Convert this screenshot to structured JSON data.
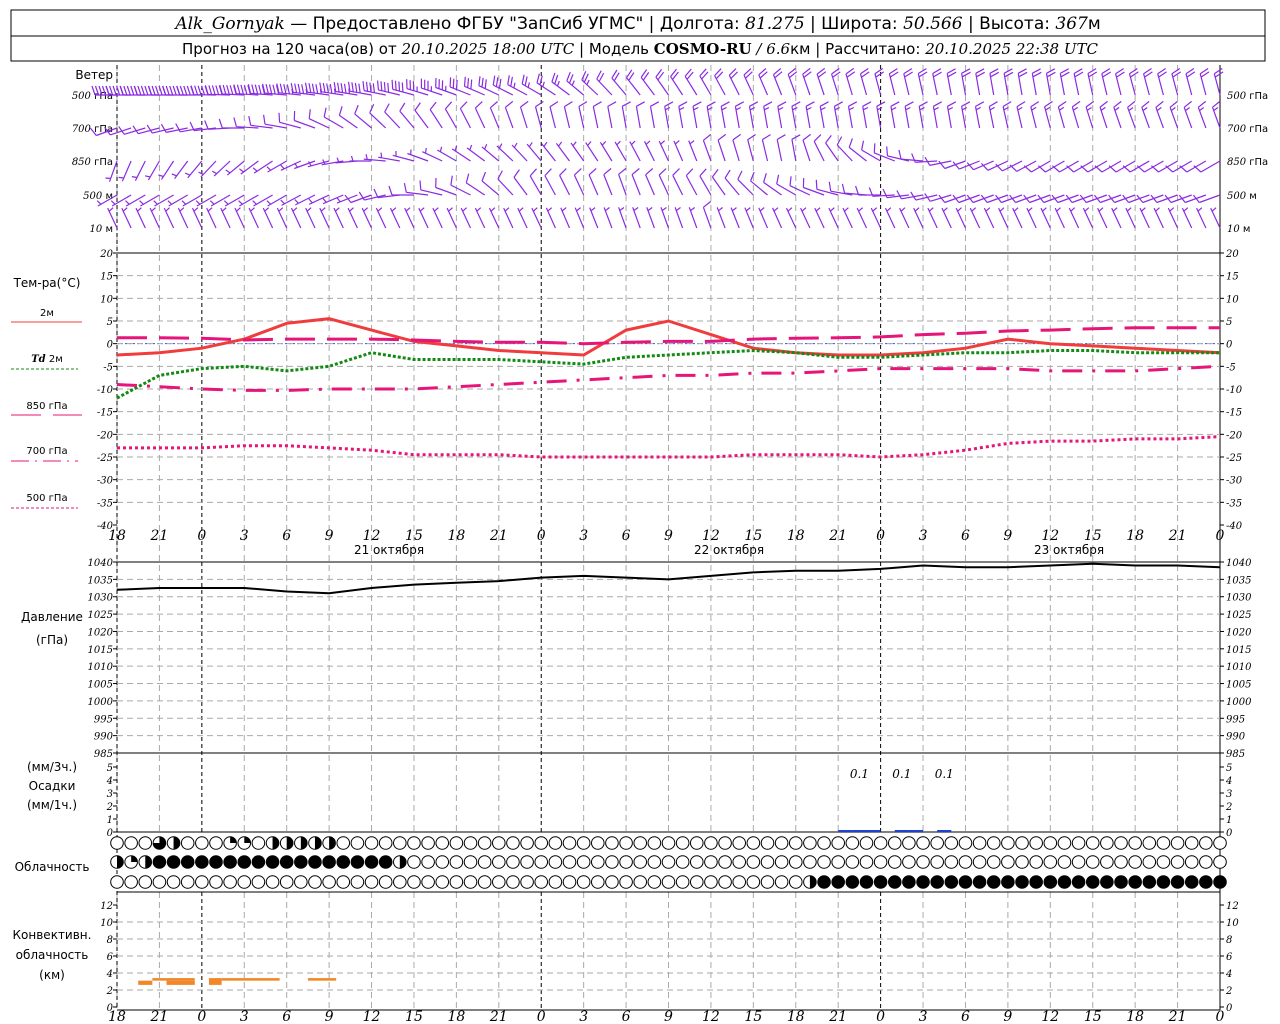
{
  "header": {
    "station": "Alk_Gornyak",
    "provided": "— Предоставлено ФГБУ \"ЗапСиб УГМС\" | Долгота:",
    "lon": "81.275",
    "lat_label": "| Широта:",
    "lat": "50.566",
    "alt_label": "| Высота:",
    "alt": "367",
    "alt_unit": "м",
    "forecast_label": "Прогноз на 120 часа(ов) от",
    "forecast_start": "20.10.2025 18:00 UTC",
    "model_label": "| Модель",
    "model": "COSMO-RU",
    "res": "/ 6.6",
    "res_unit": "км",
    "calc_label": "| Рассчитано:",
    "calc_time": "20.10.2025 22:38 UTC"
  },
  "labels": {
    "wind": "Ветер",
    "levels": [
      "500 гПа",
      "700 гПа",
      "850 гПа",
      "500 м",
      "10 м"
    ],
    "temp": "Тем-ра(°C)",
    "t2m": "2м",
    "td": "Td",
    "td2m": "2м",
    "l850": "850 гПа",
    "l700": "700 гПа",
    "l500": "500 гПа",
    "pressure": "Давление",
    "pressure_unit": "(гПа)",
    "precip3": "(мм/3ч.)",
    "precip": "Осадки",
    "precip1": "(мм/1ч.)",
    "clouds": "Облачность",
    "conv1": "Конвективн.",
    "conv2": "облачность",
    "conv3": "(км)",
    "dates": [
      "21 октября",
      "22 октября",
      "23 октября"
    ]
  },
  "colors": {
    "wind": "#8a2be2",
    "t2m": "#f03c3c",
    "td": "#138a13",
    "upper": "#e6157a",
    "precip": "#2040d0",
    "conv": "#f0882a"
  },
  "chart_data": {
    "type": "meteogram",
    "x_hours_from_start": [
      0,
      3,
      6,
      9,
      12,
      15,
      18,
      21,
      24,
      27,
      30,
      33,
      36,
      39,
      42,
      45,
      48,
      51,
      54,
      57,
      60,
      63,
      66,
      69,
      72,
      75,
      78
    ],
    "x_tick_labels": [
      "18",
      "21",
      "0",
      "3",
      "6",
      "9",
      "12",
      "15",
      "18",
      "21",
      "0",
      "3",
      "6",
      "9",
      "12",
      "15",
      "18",
      "21",
      "0",
      "3",
      "6",
      "9",
      "12",
      "15",
      "18",
      "21",
      "0"
    ],
    "temperature": {
      "ylim": [
        -40,
        20
      ],
      "yticks": [
        "20",
        "15",
        "10",
        "5",
        "0",
        "-5",
        "-10",
        "-15",
        "-20",
        "-25",
        "-30",
        "-35",
        "-40"
      ],
      "series": [
        {
          "name": "2м",
          "values": [
            -2.5,
            -2,
            -1,
            1,
            4.5,
            5.5,
            3,
            0.5,
            -0.5,
            -1.5,
            -2,
            -2.5,
            3,
            5,
            2,
            -1,
            -2,
            -2.5,
            -2.5,
            -2,
            -1,
            1,
            0,
            -0.5,
            -1,
            -1.5,
            -2
          ]
        },
        {
          "name": "Td 2м",
          "values": [
            -12,
            -7,
            -5.5,
            -5,
            -6,
            -5,
            -2,
            -3.5,
            -3.5,
            -3.5,
            -4,
            -4.5,
            -3,
            -2.5,
            -2,
            -1.5,
            -2,
            -3,
            -3,
            -2.5,
            -2,
            -2,
            -1.5,
            -1.5,
            -2,
            -2,
            -2
          ]
        },
        {
          "name": "850 гПа",
          "values": [
            1.3,
            1.3,
            1.2,
            0.8,
            1,
            1,
            1,
            0.8,
            0.5,
            0.3,
            0.3,
            0,
            0.3,
            0.5,
            0.5,
            1,
            1.2,
            1.3,
            1.5,
            2,
            2.3,
            2.8,
            3,
            3.3,
            3.5,
            3.5,
            3.5
          ]
        },
        {
          "name": "700 гПа",
          "values": [
            -9,
            -9.5,
            -10,
            -10.3,
            -10.3,
            -10,
            -10,
            -10,
            -9.5,
            -9,
            -8.5,
            -8,
            -7.5,
            -7,
            -7,
            -6.5,
            -6.5,
            -6,
            -5.5,
            -5.5,
            -5.5,
            -5.5,
            -6,
            -6,
            -6,
            -5.5,
            -5
          ]
        },
        {
          "name": "500 гПа",
          "values": [
            -23,
            -23,
            -23,
            -22.5,
            -22.5,
            -23,
            -23.5,
            -24.5,
            -24.5,
            -24.5,
            -25,
            -25,
            -25,
            -25,
            -25,
            -24.5,
            -24.5,
            -24.5,
            -25,
            -24.5,
            -23.5,
            -22,
            -21.5,
            -21.5,
            -21,
            -21,
            -20.5
          ]
        }
      ]
    },
    "pressure": {
      "ylim": [
        985,
        1040
      ],
      "yticks": [
        "1040",
        "1035",
        "1030",
        "1025",
        "1020",
        "1015",
        "1010",
        "1005",
        "1000",
        "995",
        "990",
        "985"
      ],
      "values": [
        1032,
        1032.5,
        1032.5,
        1032.5,
        1031.5,
        1031,
        1032.5,
        1033.5,
        1034,
        1034.5,
        1035.5,
        1036,
        1035.5,
        1035,
        1036,
        1037,
        1037.5,
        1037.5,
        1038,
        1039,
        1038.5,
        1038.5,
        1039,
        1039.5,
        1039,
        1039,
        1038.5
      ]
    },
    "precipitation": {
      "ylim": [
        0,
        5
      ],
      "yticks": [
        "5",
        "4",
        "3",
        "2",
        "1",
        "0"
      ],
      "hourly": [
        {
          "hour": 52,
          "mm": 0.03
        },
        {
          "hour": 53,
          "mm": 0.03
        },
        {
          "hour": 54,
          "mm": 0.03
        },
        {
          "hour": 56,
          "mm": 0.03
        },
        {
          "hour": 57,
          "mm": 0.03
        },
        {
          "hour": 59,
          "mm": 0.03
        }
      ],
      "three_hourly": [
        {
          "end_hour": 54,
          "label": "0.1"
        },
        {
          "end_hour": 57,
          "label": "0.1"
        },
        {
          "end_hour": 60,
          "label": "0.1"
        }
      ]
    },
    "cloud_cover_quarters": {
      "upper": "0003200011022222000000000000000000000000000000000000000000000000000000000000000",
      "middle": "2124444444444444444420000000000000000000000000000000000000000000000000000000000",
      "lower": "0000000000000000000000000000000000000000000000000244444444444444444444444444444"
    },
    "convective_cloud_km": {
      "ylim": [
        0,
        13
      ],
      "yticks": [
        "12",
        "10",
        "8",
        "6",
        "4",
        "2",
        "0"
      ],
      "segments": [
        [
          1.5,
          2.5,
          2.6,
          3.1
        ],
        [
          2.5,
          5.5,
          3.1,
          3.4
        ],
        [
          3.5,
          5.5,
          2.6,
          3.1
        ],
        [
          6.5,
          7.4,
          2.6,
          3.4
        ],
        [
          7.4,
          11.5,
          3.1,
          3.4
        ],
        [
          13.5,
          15.5,
          3.1,
          3.4
        ]
      ]
    },
    "wind": {
      "step_hours": 6,
      "levels": [
        {
          "name": "500 гПа",
          "dir": [
            270,
            270,
            275,
            280,
            290,
            300,
            320,
            330,
            340,
            345,
            350,
            350,
            345,
            345
          ],
          "speed": [
            25,
            25,
            25,
            22,
            18,
            14,
            12,
            12,
            12,
            12,
            12,
            12,
            12,
            12
          ]
        },
        {
          "name": "700 гПа",
          "dir": [
            250,
            260,
            280,
            310,
            330,
            345,
            350,
            350,
            350,
            350,
            350,
            345,
            340,
            340
          ],
          "speed": [
            5,
            5,
            6,
            7,
            7,
            7,
            7,
            8,
            8,
            8,
            8,
            8,
            8,
            8
          ]
        },
        {
          "name": "850 гПа",
          "dir": [
            200,
            220,
            240,
            270,
            300,
            320,
            330,
            340,
            350,
            300,
            250,
            240,
            240,
            240
          ],
          "speed": [
            4,
            4,
            4,
            3,
            3,
            3,
            4,
            5,
            5,
            5,
            5,
            5,
            5,
            6
          ]
        },
        {
          "name": "500 м",
          "dir": [
            240,
            240,
            240,
            250,
            290,
            330,
            340,
            330,
            300,
            270,
            250,
            250,
            250,
            250
          ],
          "speed": [
            3,
            3,
            4,
            5,
            6,
            6,
            5,
            5,
            6,
            6,
            6,
            6,
            6,
            6
          ]
        },
        {
          "name": "10 м",
          "dir": [
            335,
            335,
            335,
            335,
            335,
            335,
            340,
            340,
            335,
            335,
            335,
            335,
            335,
            335
          ],
          "speed": [
            4,
            4,
            4,
            4,
            4,
            4,
            4,
            5,
            4,
            4,
            4,
            4,
            4,
            4
          ]
        }
      ]
    }
  }
}
